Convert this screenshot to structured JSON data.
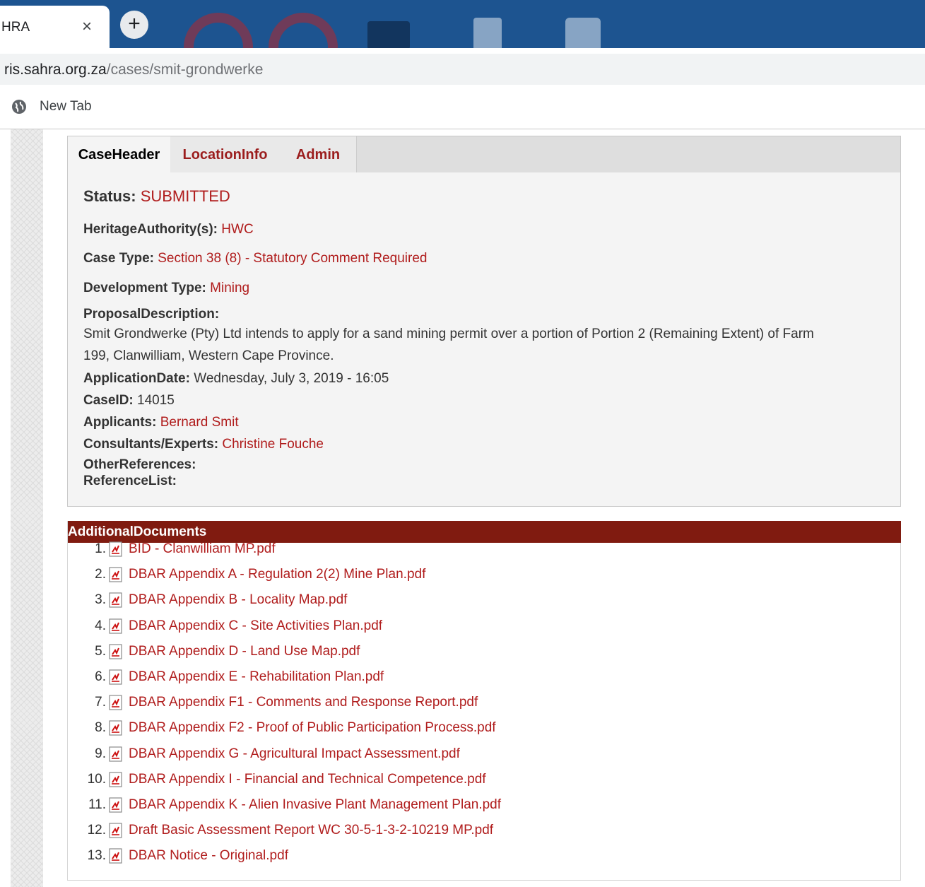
{
  "browser": {
    "tab_title": "HRA",
    "tab_close": "×",
    "new_tab_button": "+",
    "url_host": "ris.sahra.org.za",
    "url_path": "/cases/smit-grondwerke",
    "bookmark_label": "New Tab"
  },
  "case": {
    "tabs": [
      "CaseHeader",
      "LocationInfo",
      "Admin"
    ],
    "status_label": "Status:",
    "status_value": "SUBMITTED",
    "heritage_label": "HeritageAuthority(s):",
    "heritage_value": "HWC",
    "case_type_label": "Case Type:",
    "case_type_value": "Section 38 (8) - Statutory Comment Required",
    "development_type_label": "Development Type:",
    "development_type_value": "Mining",
    "proposal_label": "ProposalDescription:",
    "proposal_line1": "Smit Grondwerke (Pty) Ltd intends to apply for a sand mining permit over a portion of Portion 2 (Remaining Extent) of Farm",
    "proposal_line2": "199, Clanwilliam, Western Cape Province.",
    "application_date_label": "ApplicationDate:",
    "application_date_value": "Wednesday, July 3, 2019 - 16:05",
    "case_id_label": "CaseID:",
    "case_id_value": "14015",
    "applicants_label": "Applicants:",
    "applicants_value": "Bernard Smit",
    "consultants_label": "Consultants/Experts:",
    "consultants_value": "Christine Fouche",
    "other_refs_label": "OtherReferences:",
    "reference_list_label": "ReferenceList:"
  },
  "documents": {
    "header": "AdditionalDocuments",
    "items": [
      {
        "num": "1.",
        "name": "BID - Clanwilliam MP.pdf"
      },
      {
        "num": "2.",
        "name": "DBAR Appendix A - Regulation 2(2) Mine Plan.pdf"
      },
      {
        "num": "3.",
        "name": "DBAR Appendix B - Locality Map.pdf"
      },
      {
        "num": "4.",
        "name": "DBAR Appendix C - Site Activities Plan.pdf"
      },
      {
        "num": "5.",
        "name": "DBAR Appendix D - Land Use Map.pdf"
      },
      {
        "num": "6.",
        "name": "DBAR Appendix E - Rehabilitation Plan.pdf"
      },
      {
        "num": "7.",
        "name": "DBAR Appendix F1 - Comments and Response Report.pdf"
      },
      {
        "num": "8.",
        "name": "DBAR Appendix F2 - Proof of Public Participation Process.pdf"
      },
      {
        "num": "9.",
        "name": "DBAR Appendix G - Agricultural Impact Assessment.pdf"
      },
      {
        "num": "10.",
        "name": "DBAR Appendix I - Financial and Technical Competence.pdf"
      },
      {
        "num": "11.",
        "name": "DBAR Appendix K - Alien Invasive Plant Management Plan.pdf"
      },
      {
        "num": "12.",
        "name": "Draft Basic Assessment Report WC 30-5-1-3-2-10219 MP.pdf"
      },
      {
        "num": "13.",
        "name": "DBAR Notice - Original.pdf"
      }
    ]
  }
}
